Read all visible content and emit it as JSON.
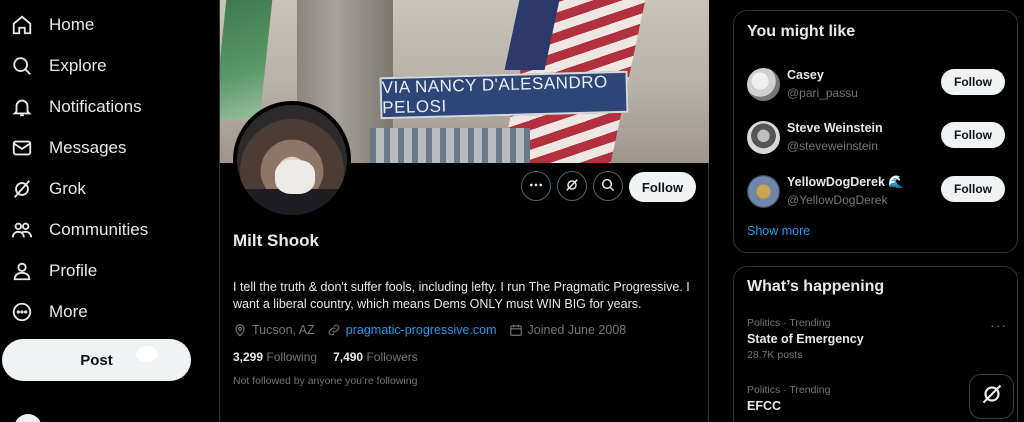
{
  "nav": {
    "items": [
      {
        "label": "Home",
        "icon": "home-icon"
      },
      {
        "label": "Explore",
        "icon": "search-icon"
      },
      {
        "label": "Notifications",
        "icon": "bell-icon"
      },
      {
        "label": "Messages",
        "icon": "mail-icon"
      },
      {
        "label": "Grok",
        "icon": "grok-icon"
      },
      {
        "label": "Communities",
        "icon": "people-icon"
      },
      {
        "label": "Profile",
        "icon": "person-icon"
      },
      {
        "label": "More",
        "icon": "more-circle-icon"
      }
    ],
    "post_label": "Post"
  },
  "banner": {
    "street_sign": "VIA NANCY D'ALESANDRO PELOSI"
  },
  "profile": {
    "name": "Milt Shook",
    "follow_label": "Follow",
    "bio": "I tell the truth & don't suffer fools, including lefty. I run The Pragmatic Progressive. I want a liberal country, which means Dems ONLY must WIN BIG for years.",
    "location": "Tucson, AZ",
    "website": "pragmatic-progressive.com",
    "joined": "Joined June 2008",
    "following_count": "3,299",
    "following_label": "Following",
    "followers_count": "7,490",
    "followers_label": "Followers",
    "followed_note": "Not followed by anyone you’re following"
  },
  "who_to_follow": {
    "title": "You might like",
    "users": [
      {
        "name": "Casey",
        "handle": "@pari_passu",
        "follow": "Follow"
      },
      {
        "name": "Steve Weinstein",
        "handle": "@steveweinstein",
        "follow": "Follow"
      },
      {
        "name": "YellowDogDerek 🌊",
        "handle": "@YellowDogDerek",
        "follow": "Follow"
      }
    ],
    "show_more": "Show more"
  },
  "happening": {
    "title": "What’s happening",
    "trends": [
      {
        "context": "Politics · Trending",
        "title": "State of Emergency",
        "count": "28.7K posts"
      },
      {
        "context": "Politics · Trending",
        "title": "EFCC",
        "count": ""
      }
    ]
  },
  "colors": {
    "accent": "#1d9bf0",
    "background": "#000000",
    "border": "#2f3336",
    "secondary_text": "#71767b"
  }
}
